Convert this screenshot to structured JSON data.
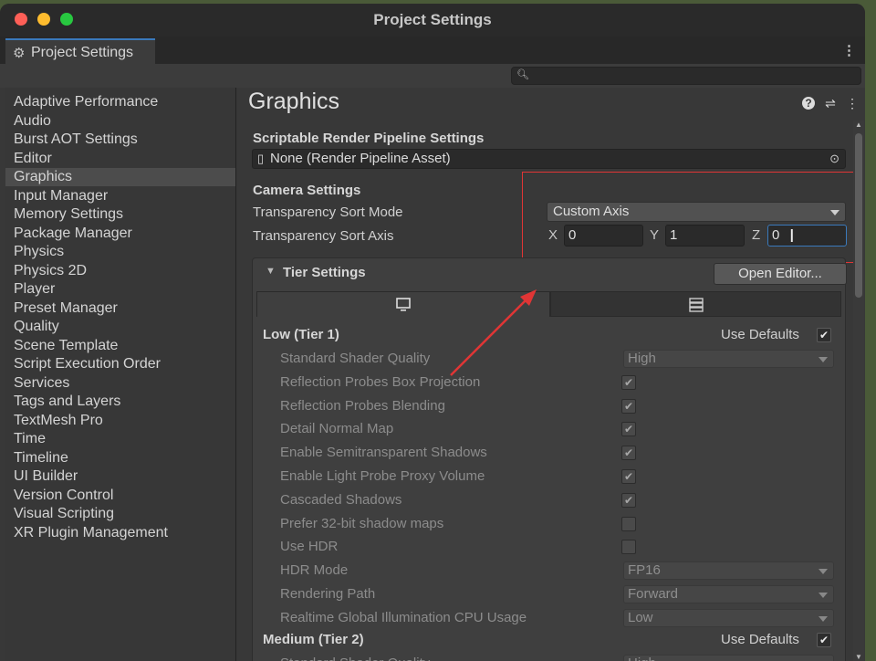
{
  "window": {
    "title": "Project Settings"
  },
  "tab": {
    "label": "Project Settings",
    "icon": "gear-icon"
  },
  "search": {
    "placeholder": "",
    "value": ""
  },
  "sidebar": {
    "items": [
      {
        "label": "Adaptive Performance"
      },
      {
        "label": "Audio"
      },
      {
        "label": "Burst AOT Settings"
      },
      {
        "label": "Editor"
      },
      {
        "label": "Graphics",
        "selected": true
      },
      {
        "label": "Input Manager"
      },
      {
        "label": "Memory Settings"
      },
      {
        "label": "Package Manager"
      },
      {
        "label": "Physics"
      },
      {
        "label": "Physics 2D"
      },
      {
        "label": "Player"
      },
      {
        "label": "Preset Manager"
      },
      {
        "label": "Quality"
      },
      {
        "label": "Scene Template"
      },
      {
        "label": "Script Execution Order"
      },
      {
        "label": "Services"
      },
      {
        "label": "Tags and Layers"
      },
      {
        "label": "TextMesh Pro"
      },
      {
        "label": "Time"
      },
      {
        "label": "Timeline"
      },
      {
        "label": "UI Builder"
      },
      {
        "label": "Version Control"
      },
      {
        "label": "Visual Scripting"
      },
      {
        "label": "XR Plugin Management"
      }
    ]
  },
  "graphics": {
    "title": "Graphics",
    "srp": {
      "heading": "Scriptable Render Pipeline Settings",
      "value": "None (Render Pipeline Asset)"
    },
    "camera": {
      "heading": "Camera Settings",
      "sort_mode_label": "Transparency Sort Mode",
      "sort_mode_value": "Custom Axis",
      "sort_axis_label": "Transparency Sort Axis",
      "axis": {
        "x_label": "X",
        "x": "0",
        "y_label": "Y",
        "y": "1",
        "z_label": "Z",
        "z": "0"
      }
    },
    "tier": {
      "heading": "Tier Settings",
      "open_editor": "Open Editor...",
      "low": {
        "title": "Low (Tier 1)",
        "use_defaults": "Use Defaults",
        "use_defaults_checked": true,
        "rows": [
          {
            "label": "Standard Shader Quality",
            "type": "dropdown",
            "value": "High"
          },
          {
            "label": "Reflection Probes Box Projection",
            "type": "check",
            "checked": true
          },
          {
            "label": "Reflection Probes Blending",
            "type": "check",
            "checked": true
          },
          {
            "label": "Detail Normal Map",
            "type": "check",
            "checked": true
          },
          {
            "label": "Enable Semitransparent Shadows",
            "type": "check",
            "checked": true
          },
          {
            "label": "Enable Light Probe Proxy Volume",
            "type": "check",
            "checked": true
          },
          {
            "label": "Cascaded Shadows",
            "type": "check",
            "checked": true
          },
          {
            "label": "Prefer 32-bit shadow maps",
            "type": "check",
            "checked": false
          },
          {
            "label": "Use HDR",
            "type": "check",
            "checked": false
          },
          {
            "label": "HDR Mode",
            "type": "dropdown",
            "value": "FP16"
          },
          {
            "label": "Rendering Path",
            "type": "dropdown",
            "value": "Forward"
          },
          {
            "label": "Realtime Global Illumination CPU Usage",
            "type": "dropdown",
            "value": "Low"
          }
        ]
      },
      "medium": {
        "title": "Medium (Tier 2)",
        "use_defaults": "Use Defaults",
        "use_defaults_checked": true,
        "rows": [
          {
            "label": "Standard Shader Quality",
            "type": "dropdown",
            "value": "High"
          }
        ]
      }
    }
  },
  "colors": {
    "annotation_red": "#e03535",
    "selection_blue": "#3a79bb",
    "close": "#fe5f57",
    "minimize": "#febc2e",
    "zoom": "#28c840"
  }
}
